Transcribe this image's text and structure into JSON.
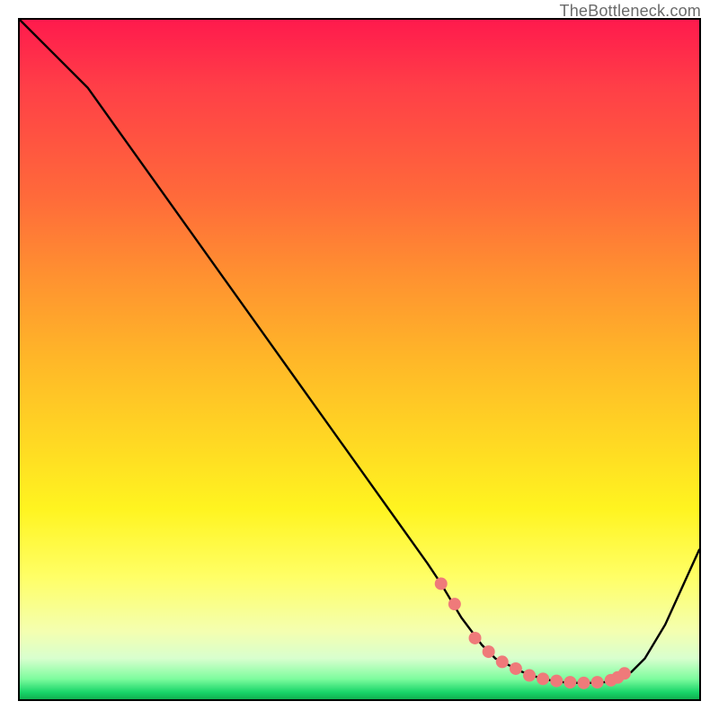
{
  "watermark": "TheBottleneck.com",
  "chart_data": {
    "type": "line",
    "title": "",
    "xlabel": "",
    "ylabel": "",
    "xlim": [
      0,
      100
    ],
    "ylim": [
      0,
      100
    ],
    "grid": false,
    "legend": false,
    "series": [
      {
        "name": "bottleneck-curve",
        "x": [
          0,
          5,
          10,
          15,
          20,
          25,
          30,
          35,
          40,
          45,
          50,
          55,
          60,
          62,
          65,
          68,
          70,
          72,
          74,
          76,
          78,
          80,
          82,
          84,
          86,
          88,
          90,
          92,
          95,
          100
        ],
        "values": [
          100,
          95,
          90,
          83,
          76,
          69,
          62,
          55,
          48,
          41,
          34,
          27,
          20,
          17,
          12,
          8,
          6,
          5,
          4,
          3.3,
          2.8,
          2.5,
          2.4,
          2.4,
          2.5,
          2.8,
          4,
          6,
          11,
          22
        ]
      }
    ],
    "markers": {
      "name": "highlight-dots",
      "color": "#ef7a7a",
      "radius_px": 7,
      "x": [
        62,
        64,
        67,
        69,
        71,
        73,
        75,
        77,
        79,
        81,
        83,
        85,
        87,
        88,
        89
      ],
      "values": [
        17,
        14,
        9,
        7,
        5.5,
        4.5,
        3.5,
        3,
        2.7,
        2.5,
        2.4,
        2.5,
        2.8,
        3.2,
        3.8
      ]
    },
    "background_gradient_stops": [
      {
        "pct": 0,
        "color": "#ff1a4d"
      },
      {
        "pct": 50,
        "color": "#ffb728"
      },
      {
        "pct": 82,
        "color": "#ffff66"
      },
      {
        "pct": 100,
        "color": "#11b050"
      }
    ]
  }
}
